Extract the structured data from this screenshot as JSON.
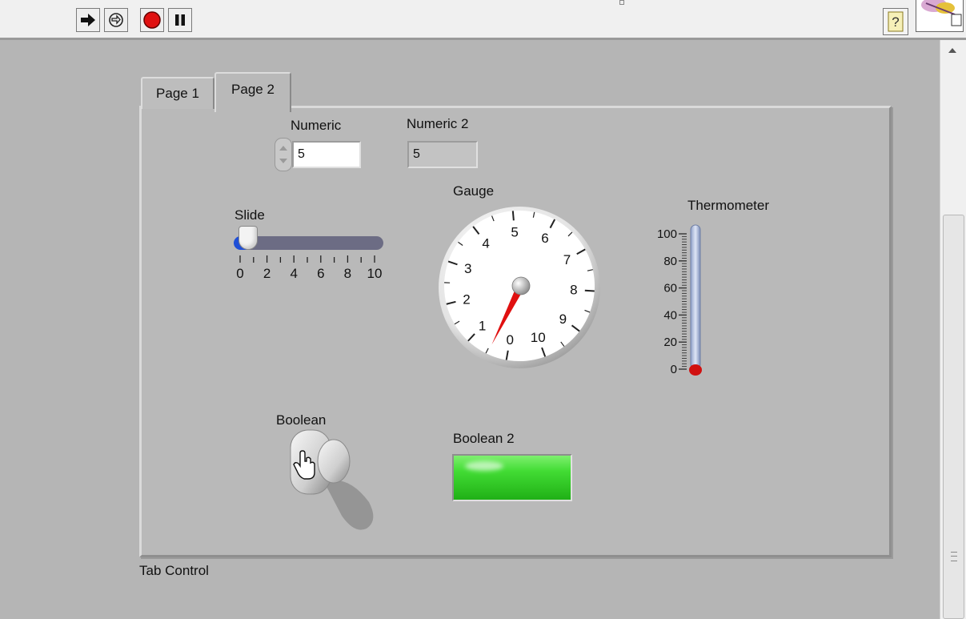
{
  "toolbar": {
    "run_icon": "run-arrow-icon",
    "run_continuously_icon": "run-continuously-icon",
    "abort_icon": "abort-stop-icon",
    "pause_icon": "pause-icon",
    "help_icon": "context-help-icon",
    "help_glyph": "?"
  },
  "tab_control": {
    "label": "Tab Control",
    "tabs": [
      {
        "label": "Page 1",
        "selected": false
      },
      {
        "label": "Page 2",
        "selected": true
      }
    ]
  },
  "numeric": {
    "label": "Numeric",
    "value": "5"
  },
  "numeric2": {
    "label": "Numeric 2",
    "value": "5"
  },
  "slide": {
    "label": "Slide",
    "value": 0,
    "min": 0,
    "max": 10,
    "tick_labels": [
      "0",
      "2",
      "4",
      "6",
      "8",
      "10"
    ]
  },
  "gauge": {
    "label": "Gauge",
    "value": 0.5,
    "min": 0,
    "max": 10,
    "tick_labels": [
      "0",
      "1",
      "2",
      "3",
      "4",
      "5",
      "6",
      "7",
      "8",
      "9",
      "10"
    ],
    "needle_color": "#e01010"
  },
  "thermometer": {
    "label": "Thermometer",
    "value": 0,
    "min": 0,
    "max": 100,
    "tick_labels": [
      "100",
      "80",
      "60",
      "40",
      "20",
      "0"
    ],
    "fill_color": "#d01010"
  },
  "boolean": {
    "label": "Boolean",
    "state": false
  },
  "boolean2": {
    "label": "Boolean 2",
    "state": true,
    "on_color": "#3ad52c"
  },
  "colors": {
    "panel": "#b5b5b5",
    "slide_track": "#6c6c84",
    "slide_fill": "#1f4fd6"
  }
}
